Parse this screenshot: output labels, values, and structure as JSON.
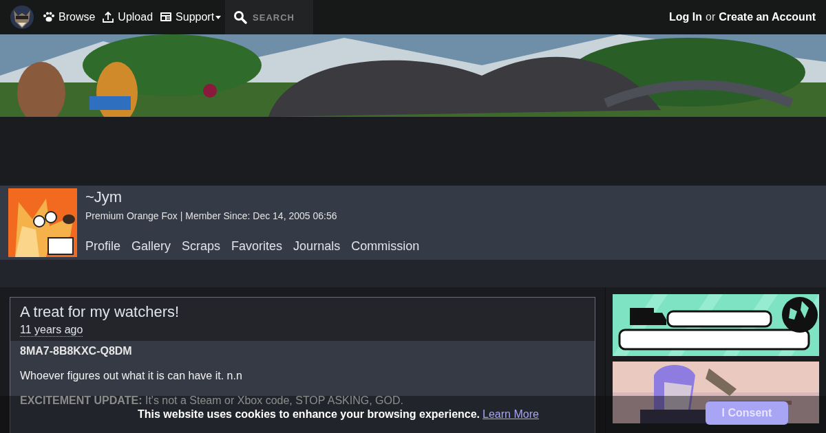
{
  "nav": {
    "items": [
      {
        "kind": "paw",
        "label": "Browse"
      },
      {
        "kind": "upload",
        "label": "Upload"
      },
      {
        "kind": "support",
        "label": "Support",
        "dropdown": true
      }
    ],
    "search": {
      "placeholder": "SEARCH"
    },
    "login": "Log In",
    "or": "or",
    "register": "Create an Account"
  },
  "profile": {
    "name": "~Jym",
    "subtitle": "Premium Orange Fox | Member Since: Dec 14, 2005 06:56",
    "tabs": [
      {
        "label": "Profile",
        "selected": false
      },
      {
        "label": "Gallery",
        "selected": false
      },
      {
        "label": "Scraps",
        "selected": false
      },
      {
        "label": "Favorites",
        "selected": false
      },
      {
        "label": "Journals",
        "selected": false
      },
      {
        "label": "Commission",
        "selected": false
      }
    ]
  },
  "journal": {
    "title": "A treat for my watchers!",
    "time": "11 years ago",
    "code": "8MA7-8B8KXC-Q8DM",
    "text": "Whoever figures out what it is can have it. n.n",
    "update": "**EXCITEMENT UPDATE:** It's not a Steam or Xbox code, STOP ASKING, GOD."
  },
  "cookie": {
    "text": "This website uses cookies to enhance your browsing experience.",
    "link": "Learn More",
    "button": "I Consent"
  }
}
